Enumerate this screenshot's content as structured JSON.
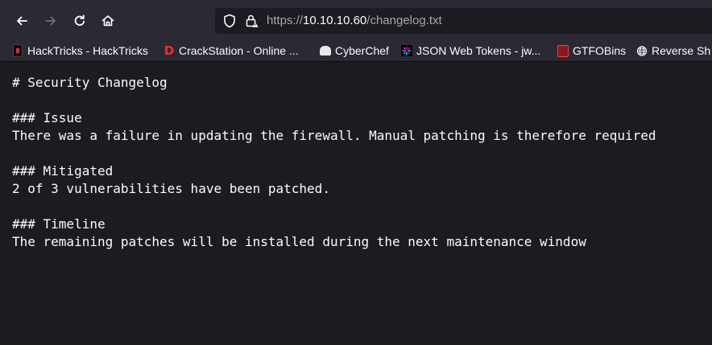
{
  "browser": {
    "url": {
      "scheme": "https://",
      "host": "10.10.10.60",
      "path": "/changelog.txt"
    },
    "bookmarks": [
      {
        "label": "HackTricks - HackTricks",
        "icon": "hacktricks-icon"
      },
      {
        "label": "CrackStation - Online ...",
        "icon": "crackstation-icon"
      },
      {
        "label": "CyberChef",
        "icon": "cyberchef-icon"
      },
      {
        "label": "JSON Web Tokens - jw...",
        "icon": "jwt-icon"
      },
      {
        "label": "GTFOBins",
        "icon": "gtfobins-icon"
      },
      {
        "label": "Reverse Sh",
        "icon": "globe-icon"
      }
    ]
  },
  "document": {
    "lines": [
      "# Security Changelog",
      "### Issue",
      "There was a failure in updating the firewall. Manual patching is therefore required",
      "### Mitigated",
      "2 of 3 vulnerabilities have been patched.",
      "### Timeline",
      "The remaining patches will be installed during the next maintenance window"
    ]
  },
  "colors": {
    "toolbar_bg": "#2b2a33",
    "page_bg": "#1c1b22",
    "text": "#fbfbfe",
    "muted_text": "#a6a6ad"
  }
}
